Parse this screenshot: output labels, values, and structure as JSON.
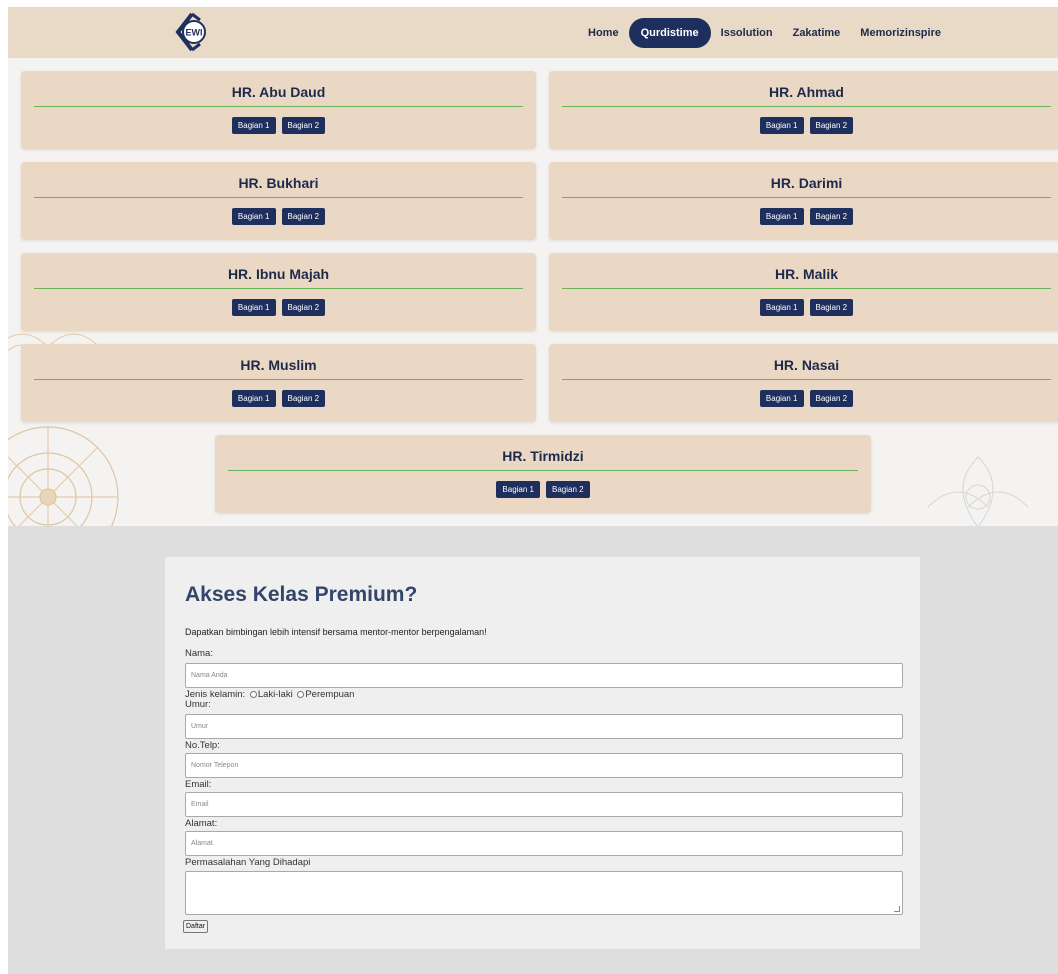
{
  "navbar": {
    "logo_text": "EWI",
    "links": [
      {
        "label": "Home"
      },
      {
        "label": "Qurdistime",
        "active": true
      },
      {
        "label": "Issolution"
      },
      {
        "label": "Zakatime"
      },
      {
        "label": "Memorizinspire"
      }
    ]
  },
  "hadith_cards": [
    {
      "title": "HR. Abu Daud",
      "buttons": [
        "Bagian 1",
        "Bagian 2"
      ]
    },
    {
      "title": "HR. Ahmad",
      "buttons": [
        "Bagian 1",
        "Bagian 2"
      ]
    },
    {
      "title": "HR. Bukhari",
      "buttons": [
        "Bagian 1",
        "Bagian 2"
      ]
    },
    {
      "title": "HR. Darimi",
      "buttons": [
        "Bagian 1",
        "Bagian 2"
      ]
    },
    {
      "title": "HR. Ibnu Majah",
      "buttons": [
        "Bagian 1",
        "Bagian 2"
      ]
    },
    {
      "title": "HR. Malik",
      "buttons": [
        "Bagian 1",
        "Bagian 2"
      ]
    },
    {
      "title": "HR. Muslim",
      "buttons": [
        "Bagian 1",
        "Bagian 2"
      ]
    },
    {
      "title": "HR. Nasai",
      "buttons": [
        "Bagian 1",
        "Bagian 2"
      ]
    },
    {
      "title": "HR. Tirmidzi",
      "buttons": [
        "Bagian 1",
        "Bagian 2"
      ]
    }
  ],
  "form": {
    "title": "Akses Kelas Premium?",
    "description": "Dapatkan bimbingan lebih intensif bersama mentor-mentor berpengalaman!",
    "nama_label": "Nama:",
    "nama_placeholder": "Nama Anda",
    "gender_label": "Jenis kelamin:",
    "gender_options": [
      "Laki-laki",
      "Perempuan"
    ],
    "umur_label": "Umur:",
    "umur_placeholder": "Umur",
    "telp_label": "No.Telp:",
    "telp_placeholder": "Nomor Telepon",
    "email_label": "Email:",
    "email_placeholder": "Email",
    "alamat_label": "Alamat:",
    "alamat_placeholder": "Alamat",
    "masalah_label": "Permasalahan Yang Dihadapi",
    "submit_label": "Daftar"
  },
  "colors": {
    "navbar_bg": "#e9d9c7",
    "card_bg": "#ead8c5",
    "accent_navy": "#1e2f5e",
    "divider_green": "#6bb35a",
    "form_title": "#34456a"
  }
}
